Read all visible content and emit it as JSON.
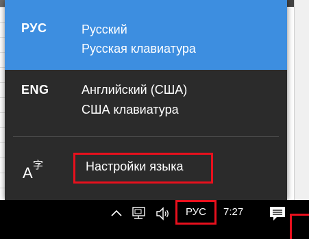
{
  "language_flyout": {
    "languages": [
      {
        "code": "РУС",
        "name": "Русский",
        "keyboard": "Русская клавиатура",
        "selected": true
      },
      {
        "code": "ENG",
        "name": "Английский (США)",
        "keyboard": "США клавиатура",
        "selected": false
      }
    ],
    "settings_label": "Настройки языка",
    "settings_icon": "language-settings-icon",
    "colors": {
      "active_background": "#3d8ee0",
      "flyout_background": "#2b2b2b",
      "highlight_border": "#e8101d"
    }
  },
  "taskbar": {
    "input_indicator": "РУС",
    "clock": "7:27",
    "icons": [
      "chevron-up-icon",
      "network-icon",
      "volume-icon",
      "action-center-icon"
    ]
  }
}
